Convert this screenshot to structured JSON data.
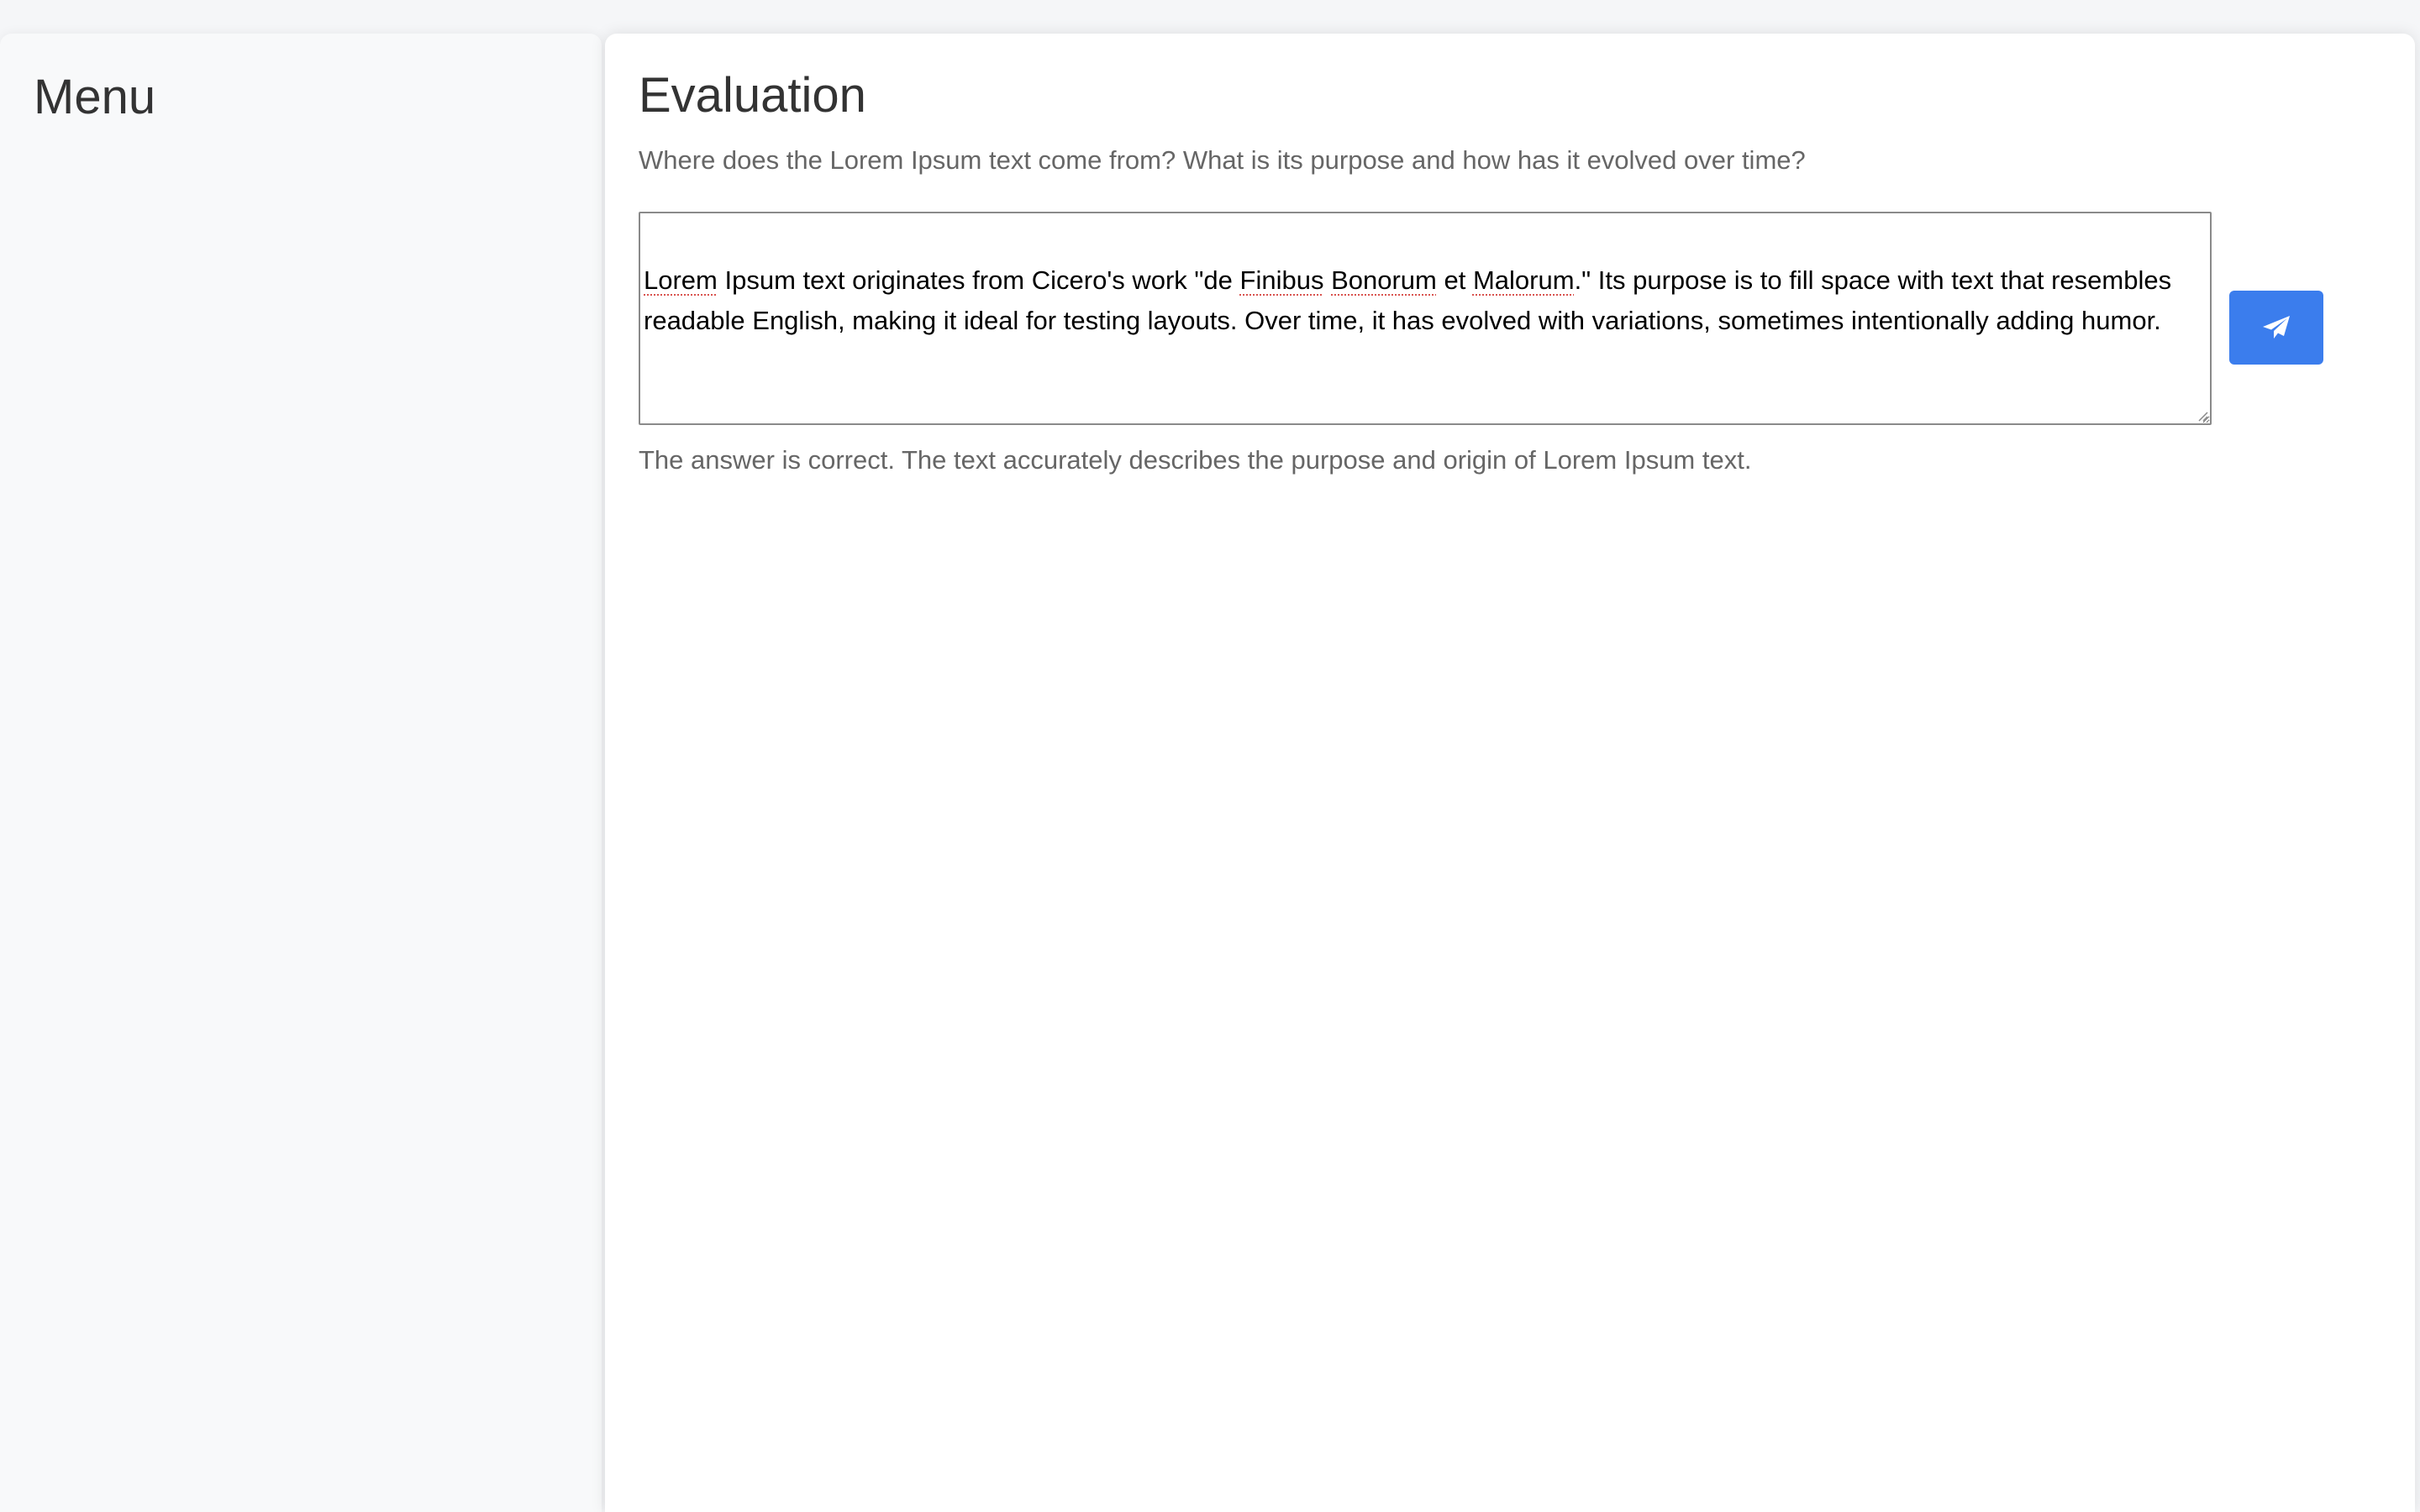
{
  "sidebar": {
    "title": "Menu"
  },
  "main": {
    "title": "Evaluation",
    "question": "Where does the Lorem Ipsum text come from? What is its purpose and how has it evolved over time?",
    "answer": {
      "w1": "Lorem",
      "p1": " Ipsum text originates from Cicero's work \"de ",
      "w2": "Finibus",
      "p2": " ",
      "w3": "Bonorum",
      "p3": " et ",
      "w4": "Malorum",
      "p4": ".\" Its purpose is to fill space with text that resembles readable English, making it ideal for testing layouts. Over time, it has evolved with variations, sometimes intentionally adding humor."
    },
    "send_button_icon": "paper-plane-icon",
    "feedback": "The answer is correct. The text accurately describes the purpose and origin of Lorem Ipsum text."
  },
  "colors": {
    "accent": "#3b7ded",
    "page_background": "#f5f6f8",
    "sidebar_background": "#f8f9fa",
    "main_background": "#ffffff",
    "muted_text": "#666666",
    "heading_text": "#333333",
    "spellcheck_underline": "#d9534f"
  }
}
